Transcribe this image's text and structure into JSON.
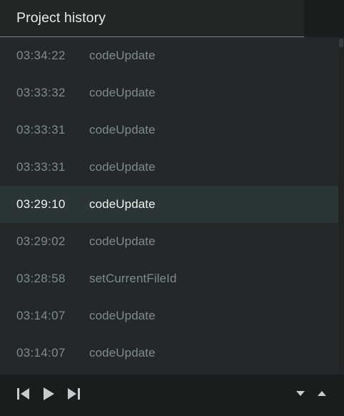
{
  "header": {
    "title": "Project history",
    "info_icon": "info-icon",
    "info_color": "#ee7f7c"
  },
  "history": [
    {
      "time": "03:34:22",
      "action": "codeUpdate",
      "selected": false
    },
    {
      "time": "03:33:32",
      "action": "codeUpdate",
      "selected": false
    },
    {
      "time": "03:33:31",
      "action": "codeUpdate",
      "selected": false
    },
    {
      "time": "03:33:31",
      "action": "codeUpdate",
      "selected": false
    },
    {
      "time": "03:29:10",
      "action": "codeUpdate",
      "selected": true
    },
    {
      "time": "03:29:02",
      "action": "codeUpdate",
      "selected": false
    },
    {
      "time": "03:28:58",
      "action": "setCurrentFileId",
      "selected": false
    },
    {
      "time": "03:14:07",
      "action": "codeUpdate",
      "selected": false
    },
    {
      "time": "03:14:07",
      "action": "codeUpdate",
      "selected": false
    }
  ],
  "controls": {
    "left": [
      "skip-to-start-icon",
      "play-icon",
      "skip-to-end-icon"
    ],
    "right": [
      "caret-down-icon",
      "caret-up-icon"
    ]
  },
  "colors": {
    "background": "#252828",
    "selected_row": "#2c3535",
    "accent_rule": "#5d8d8f",
    "muted_text": "#7f8b8c",
    "selected_text": "#f2f3f3"
  }
}
